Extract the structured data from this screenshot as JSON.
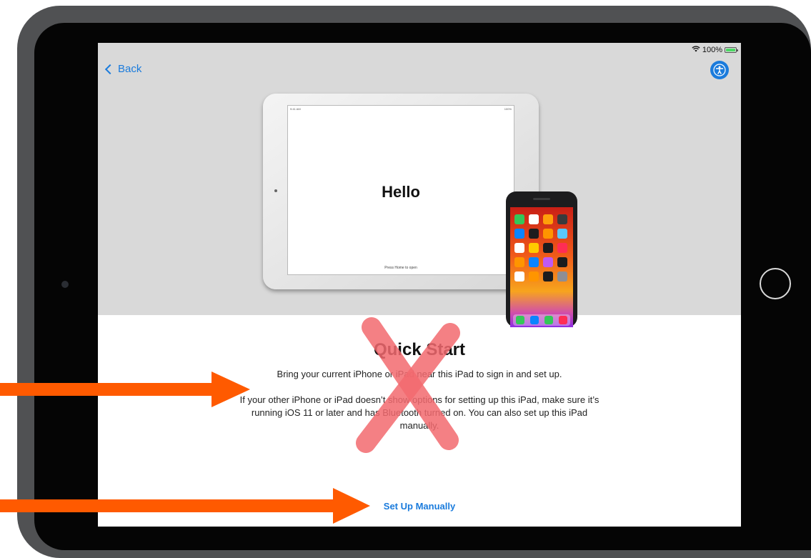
{
  "status_bar": {
    "battery_percent": "100%",
    "wifi_icon": "wifi-icon",
    "battery_icon": "battery-icon"
  },
  "nav": {
    "back_label": "Back",
    "accessibility_icon": "accessibility-icon"
  },
  "illustration": {
    "ipad_screen_title": "Hello",
    "ipad_screen_hint": "Press Home to open"
  },
  "content": {
    "title": "Quick Start",
    "line1": "Bring your current iPhone or iPad near this iPad to sign in and set up.",
    "line2": "If your other iPhone or iPad doesn’t show options for setting up this iPad, make sure it’s running iOS 11 or later and has Bluetooth turned on. You can also set up this iPad manually.",
    "manual_button": "Set Up Manually"
  },
  "annotations": {
    "cross_mark": "red-x-mark",
    "arrow_color": "#ff5a00",
    "cross_color": "#f36a6f"
  },
  "colors": {
    "accent": "#1a7bdc",
    "hero_bg": "#d9d9d9"
  }
}
